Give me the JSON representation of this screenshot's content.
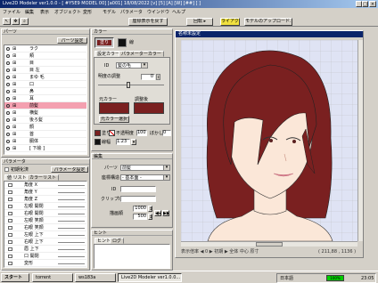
{
  "window": {
    "title": "Live2D Modeler ver1.0.0 - [ #Y5E9 MODEL 00] [a001] 18/08/2022 [v] [5] [A] [W] [##] [ ]"
  },
  "menu": [
    "ファイル",
    "編集",
    "表示",
    "オブジェクト",
    "変形",
    "モデル",
    "パラメータ",
    "ウインドウ",
    "ヘルプ"
  ],
  "toolbar": {
    "btn1": "座標表示を戻す",
    "btn2": "回転 ▸",
    "btn3": "ライアクト",
    "btn4": "モデルのアップロード..."
  },
  "parts": {
    "title": "パーツ",
    "settings_btn": "パーツ設定",
    "items": [
      "ラク",
      "頬",
      "目",
      "目 左",
      "まゆ 毛",
      "口",
      "鼻",
      "耳",
      "前髪",
      "横髪",
      "後ろ髪",
      "顔",
      "首",
      "胴体",
      "[ 下絵 ]"
    ],
    "selected_index": 8
  },
  "color": {
    "title": "カラー",
    "btn": "塗り",
    "swatch_label": "線",
    "tab1": "設定カラー",
    "tab2": "パラメーターカラー",
    "id_label": "ID",
    "id_value": "髪の毛",
    "opacity_label": "明度の調整",
    "opacity_value": "0",
    "before_label": "元カラー",
    "after_label": "調整後",
    "reset_btn": "元カラー選択",
    "fill_label": "塗り",
    "transparency_label": "不透明度",
    "transparency_value": "100",
    "blur_label": "ぼかし",
    "blur_value": "0",
    "line_label": "線幅",
    "line_value": "1.23",
    "fill_color": "#7a2020",
    "swatch_color": "#111111"
  },
  "edit": {
    "title": "編集",
    "part_label": "パーツ",
    "part_value": "前髪",
    "coord_label": "座標構造",
    "coord_value": "- 基本面 -",
    "id_label": "ID",
    "clip_label": "クリップID",
    "order_label": "描画順",
    "order_value1": "1000",
    "order_value2": "500"
  },
  "params": {
    "title": "パラメータ",
    "check_label": "初期化済",
    "setting_btn": "パラメータ設定",
    "tab1": "値 リスト",
    "tab2": "カラーリスト",
    "items": [
      "角度 X",
      "角度 Y",
      "角度 Z",
      "左眼 開閉",
      "右眼 開閉",
      "左眼 笑顔",
      "右眼 笑顔",
      "左眼 上下",
      "右眼 上下",
      "眉 上下",
      "口 開閉",
      "変形"
    ]
  },
  "hint": {
    "title": "ヒント",
    "tab1": "ヒント",
    "tab2": "ログ"
  },
  "canvas": {
    "title": "名称未設定",
    "status": "表示倍率 ◀ 0  ▶ 初期 ▶ 全体 中心 原寸",
    "coords": "( 211,88 , 1136 )",
    "hair_color": "#7a2020",
    "skin_color": "#fbe7d8"
  },
  "taskbar": {
    "start": "スタート",
    "items": [
      "torrent",
      "ws183a",
      "Live2D Modeler ver1.0.0..."
    ],
    "tray": "日本語",
    "clock": "23:05",
    "level": "100%"
  }
}
